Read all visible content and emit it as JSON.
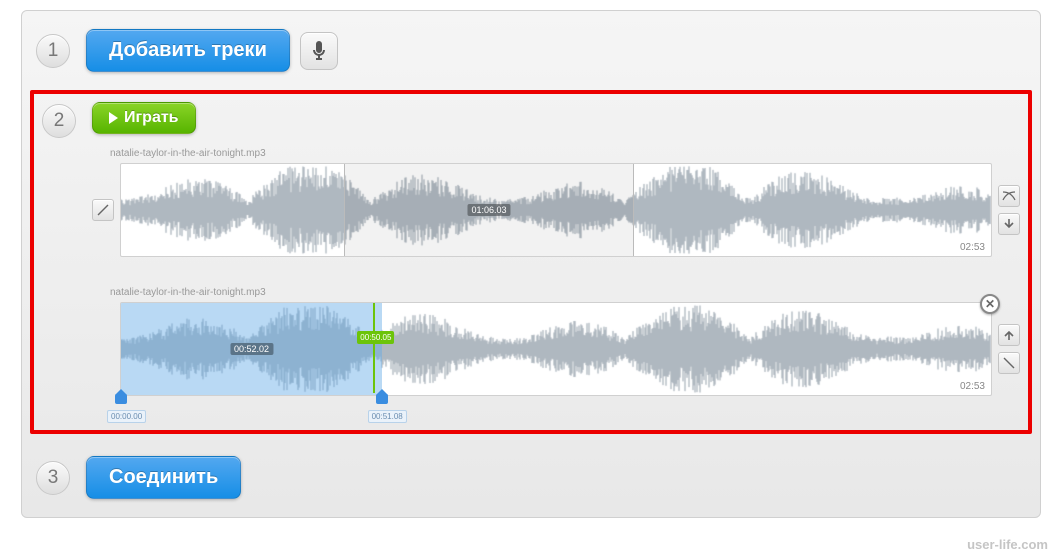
{
  "step1": {
    "number": "1",
    "add_label": "Добавить треки"
  },
  "step2": {
    "number": "2",
    "play_label": "Играть",
    "tracks": [
      {
        "filename": "natalie-taylor-in-the-air-tonight.mp3",
        "duration": "02:53",
        "center_time": "01:06.03",
        "sel_start_pct": 25.6,
        "sel_end_pct": 59
      },
      {
        "filename": "natalie-taylor-in-the-air-tonight.mp3",
        "duration": "02:53",
        "sel_time_label": "00:52.02",
        "marker_time": "00:50.05",
        "handle_start": "00:00.00",
        "handle_end": "00:51.08",
        "sel_start_pct": 0,
        "sel_end_pct": 30,
        "marker_pct": 29
      }
    ]
  },
  "step3": {
    "number": "3",
    "join_label": "Соединить"
  },
  "watermark": "user-life.com"
}
